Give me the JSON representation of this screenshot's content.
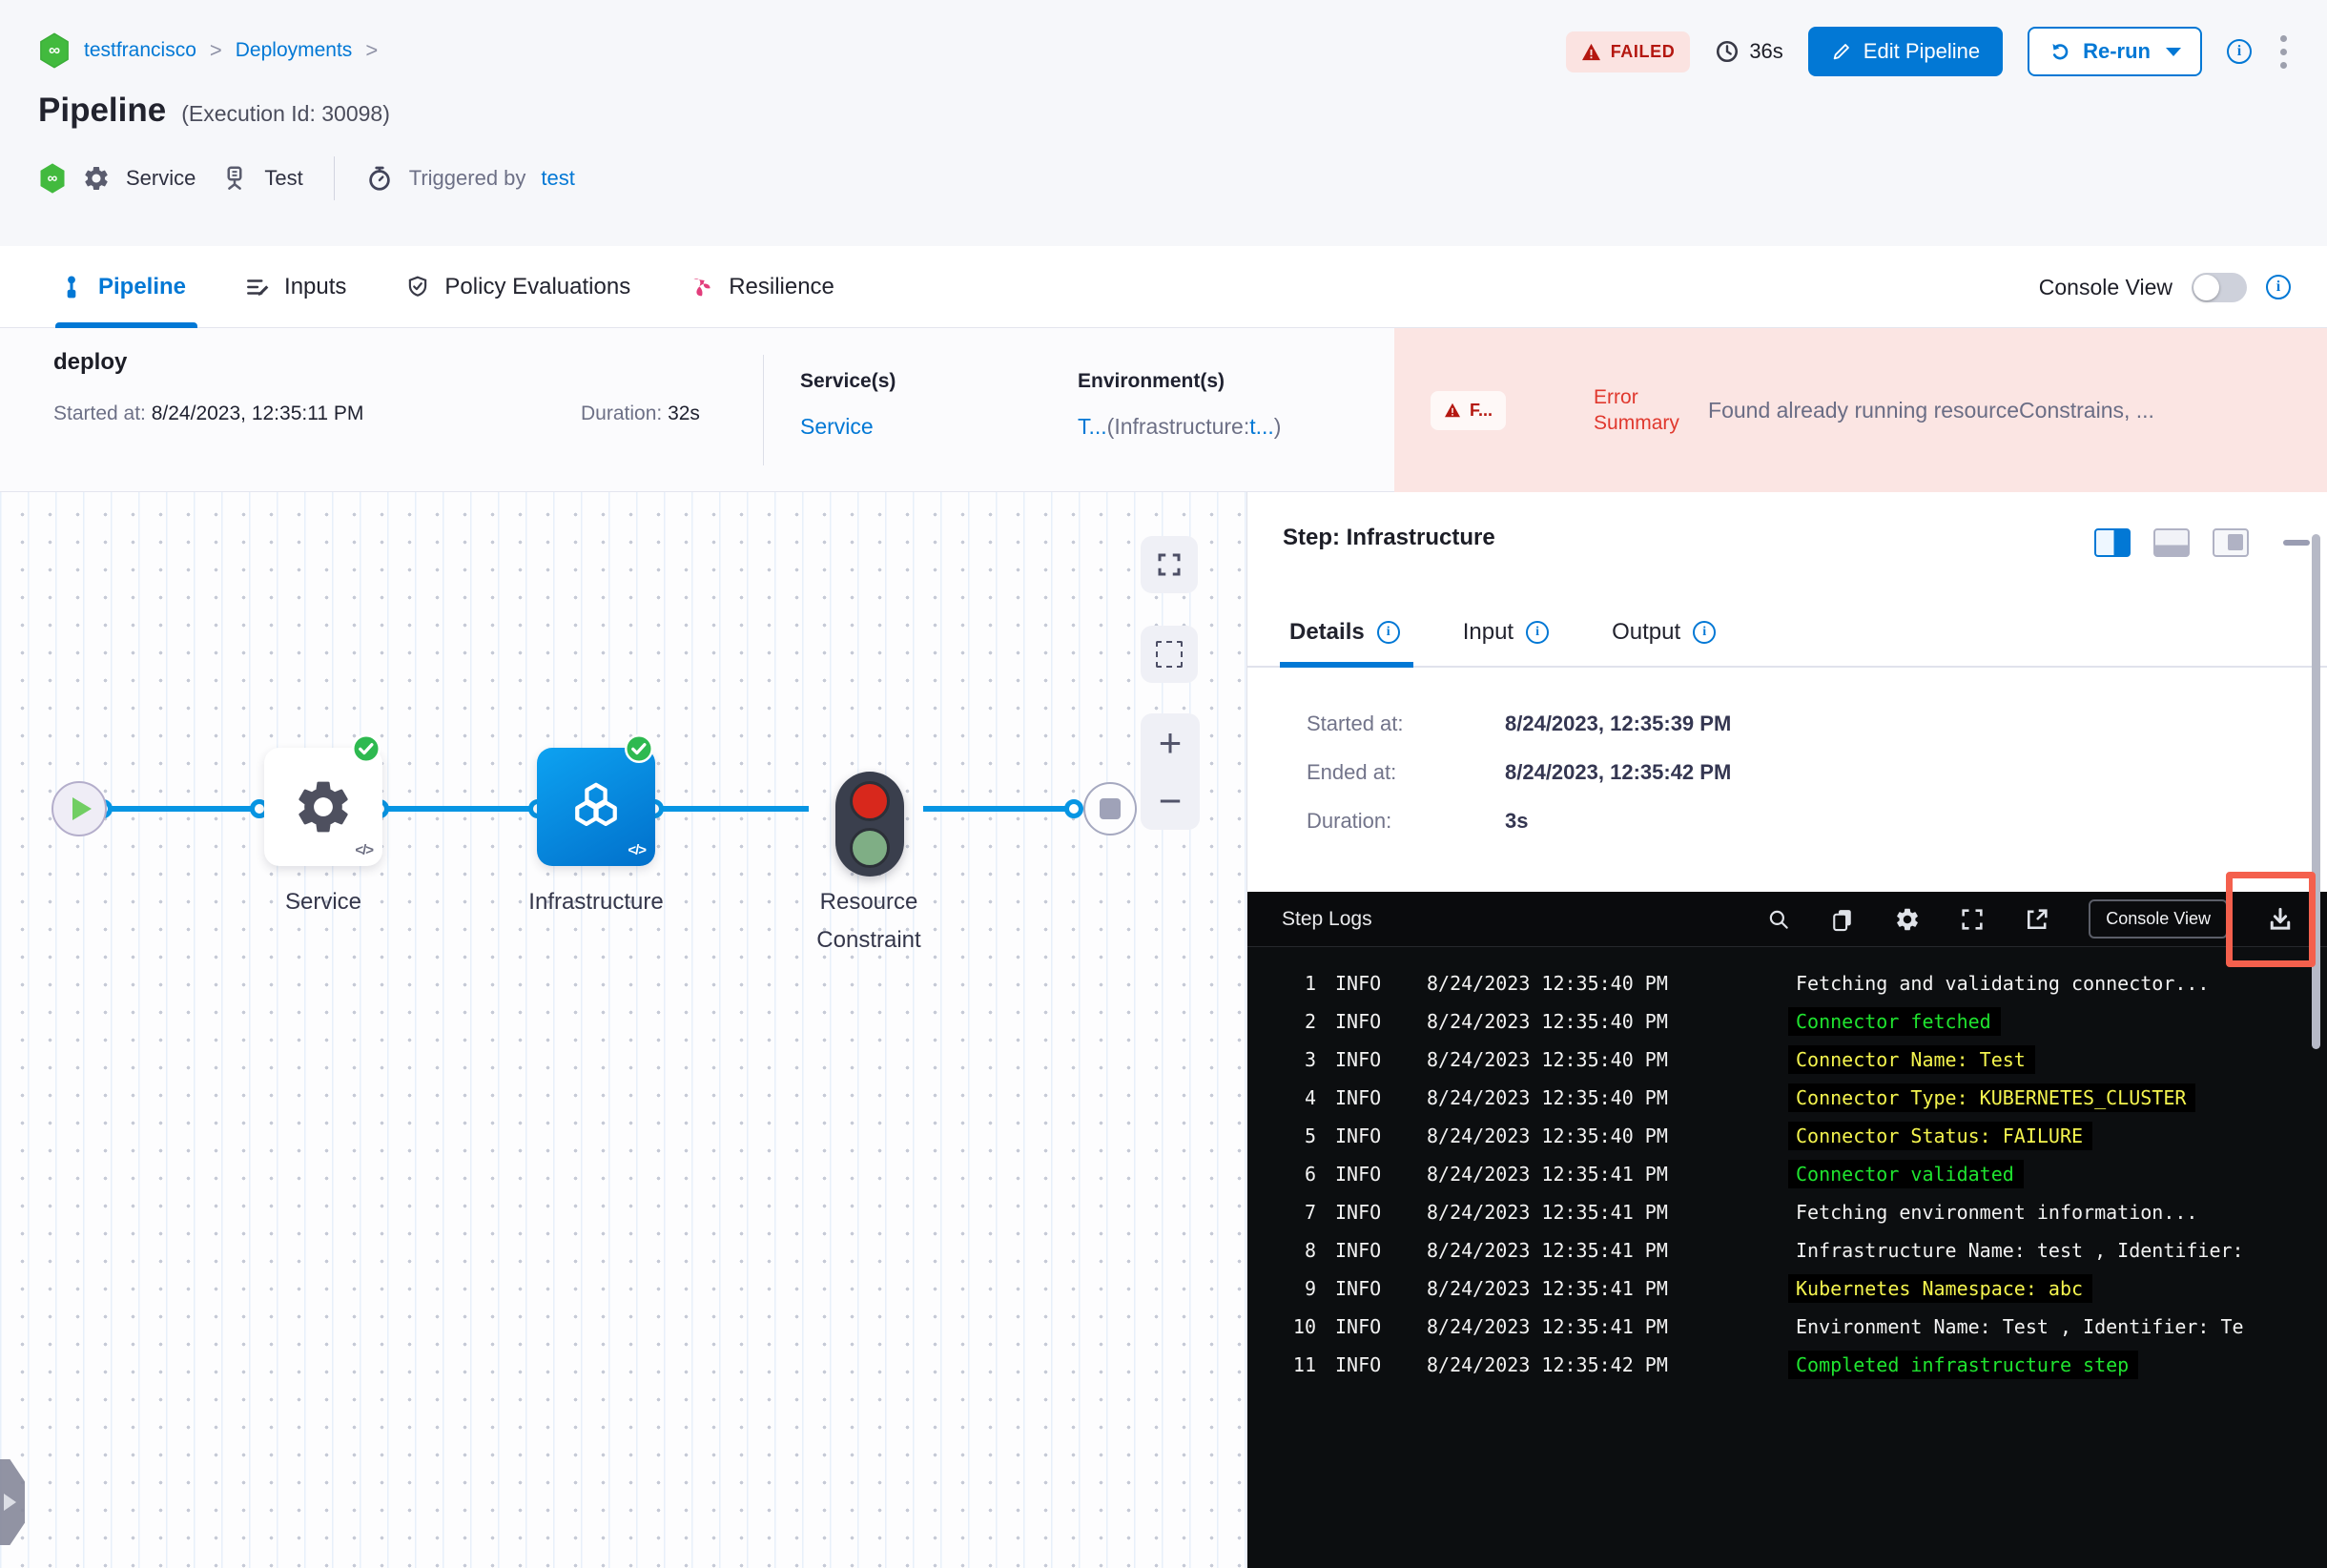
{
  "colors": {
    "accent": "#0278D5",
    "failed_red": "#B41710",
    "error_bg": "#FBE5E3",
    "line_blue": "#0795E3",
    "success_green": "#2EB950",
    "log_green": "#1FE42F",
    "log_yellow": "#F4F44E",
    "highlight_red": "#F4604D"
  },
  "breadcrumb": {
    "project": "testfrancisco",
    "section": "Deployments",
    "sep": ">"
  },
  "status": {
    "failed": "FAILED",
    "elapsed": "36s"
  },
  "actions": {
    "edit": "Edit Pipeline",
    "rerun": "Re-run"
  },
  "title": {
    "name": "Pipeline",
    "execution": "(Execution Id: 30098)"
  },
  "meta": {
    "service": "Service",
    "test": "Test",
    "triggered_by": "Triggered by",
    "trigger_user": "test"
  },
  "tabs": {
    "pipeline": "Pipeline",
    "inputs": "Inputs",
    "policy": "Policy Evaluations",
    "resilience": "Resilience",
    "console_view": "Console View"
  },
  "stage": {
    "name": "deploy",
    "started_label": "Started at:",
    "started_value": "8/24/2023, 12:35:11 PM",
    "duration_label": "Duration:",
    "duration_value": "32s",
    "services_label": "Service(s)",
    "service_link": "Service",
    "environments_label": "Environment(s)",
    "env_t": "T...",
    "env_mid": "(Infrastructure:",
    "env_t2": "t...",
    "env_close": ")",
    "failed_short": "F...",
    "error_label": "Error Summary",
    "error_message": "Found already running resourceConstrains, ..."
  },
  "graph": {
    "service": "Service",
    "infrastructure": "Infrastructure",
    "resource_constraint": "Resource Constraint",
    "code": "</>"
  },
  "step_panel": {
    "title": "Step: Infrastructure",
    "tabs": {
      "details": "Details",
      "input": "Input",
      "output": "Output"
    },
    "details": {
      "started_label": "Started at:",
      "started": "8/24/2023, 12:35:39 PM",
      "ended_label": "Ended at:",
      "ended": "8/24/2023, 12:35:42 PM",
      "duration_label": "Duration:",
      "duration": "3s"
    }
  },
  "logs": {
    "title": "Step Logs",
    "console_button": "Console View",
    "lines": [
      {
        "num": "1",
        "level": "INFO",
        "time": "8/24/2023 12:35:40 PM",
        "msg": "Fetching and validating connector...",
        "color": "white"
      },
      {
        "num": "2",
        "level": "INFO",
        "time": "8/24/2023 12:35:40 PM",
        "msg": "Connector fetched",
        "color": "green"
      },
      {
        "num": "3",
        "level": "INFO",
        "time": "8/24/2023 12:35:40 PM",
        "msg": "Connector Name: Test",
        "color": "yellow"
      },
      {
        "num": "4",
        "level": "INFO",
        "time": "8/24/2023 12:35:40 PM",
        "msg": "Connector Type: KUBERNETES_CLUSTER",
        "color": "yellow"
      },
      {
        "num": "5",
        "level": "INFO",
        "time": "8/24/2023 12:35:40 PM",
        "msg": "Connector Status: FAILURE",
        "color": "yellow"
      },
      {
        "num": "6",
        "level": "INFO",
        "time": "8/24/2023 12:35:41 PM",
        "msg": "Connector validated",
        "color": "green"
      },
      {
        "num": "7",
        "level": "INFO",
        "time": "8/24/2023 12:35:41 PM",
        "msg": "Fetching environment information...",
        "color": "white"
      },
      {
        "num": "8",
        "level": "INFO",
        "time": "8/24/2023 12:35:41 PM",
        "msg": "Infrastructure Name: test , Identifier:",
        "color": "white"
      },
      {
        "num": "9",
        "level": "INFO",
        "time": "8/24/2023 12:35:41 PM",
        "msg": "Kubernetes Namespace: abc",
        "color": "yellow"
      },
      {
        "num": "10",
        "level": "INFO",
        "time": "8/24/2023 12:35:41 PM",
        "msg": "Environment Name: Test , Identifier: Te",
        "color": "white"
      },
      {
        "num": "11",
        "level": "INFO",
        "time": "8/24/2023 12:35:42 PM",
        "msg": "Completed infrastructure step",
        "color": "green"
      }
    ]
  }
}
